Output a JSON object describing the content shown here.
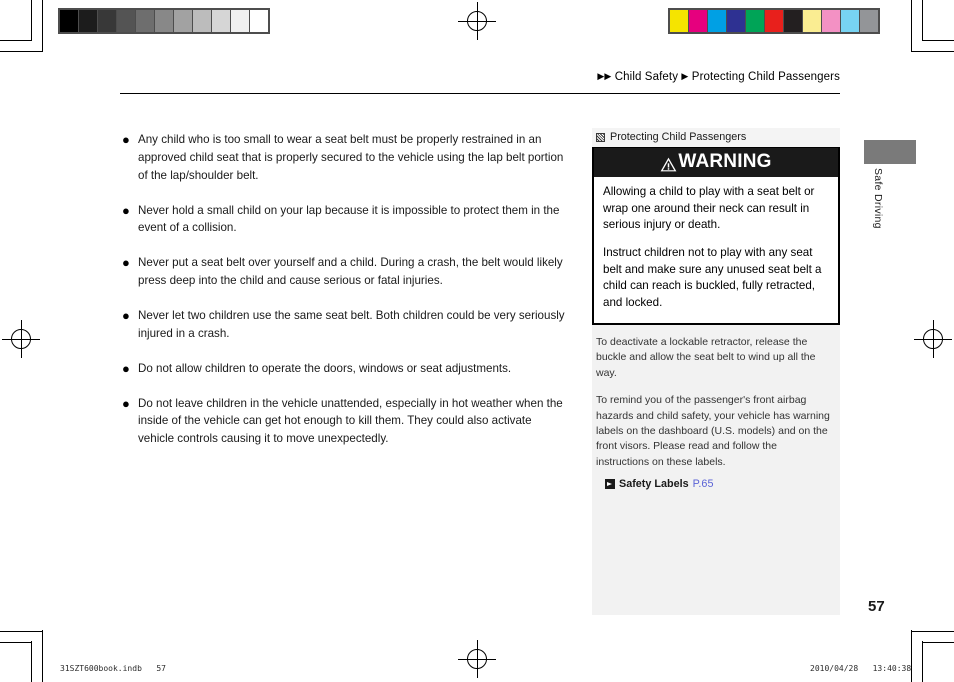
{
  "breadcrumb": {
    "arrow_glyph": "▶",
    "section": "Child Safety",
    "subsection": "Protecting Child Passengers"
  },
  "main": {
    "bullet_glyph": "●",
    "bullets": [
      "Any child who is too small to wear a seat belt must be properly restrained in an approved child seat that is properly secured to the vehicle using the lap belt portion of the lap/shoulder belt.",
      "Never hold a small child on your lap because it is impossible to protect them in the event of a collision.",
      "Never put a seat belt over yourself and a child. During a crash, the belt would likely press deep into the child and cause serious or fatal injuries.",
      "Never let two children use the same seat belt. Both children could be very seriously injured in a crash.",
      "Do not allow children to operate the doors, windows or seat adjustments.",
      "Do not leave children in the vehicle unattended, especially in hot weather when the inside of the vehicle can get hot enough to kill them. They could also activate vehicle controls causing it to move unexpectedly."
    ]
  },
  "sidebar": {
    "header_label": "Protecting Child Passengers",
    "warning": {
      "title": "WARNING",
      "paragraphs": [
        "Allowing a child to play with a seat belt or wrap one around their neck can result in serious injury or death.",
        "Instruct children not to play with any seat belt and make sure any unused seat belt a child can reach is buckled, fully retracted, and locked."
      ]
    },
    "notes": [
      "To deactivate a lockable retractor, release the buckle and allow the seat belt to wind up all the way.",
      "To remind you of the passenger's front airbag hazards and child safety, your vehicle has warning labels on the dashboard (U.S. models) and on the front visors. Please read and follow the instructions on these labels."
    ],
    "cross_reference": {
      "label": "Safety Labels",
      "page": "P.65"
    }
  },
  "side_tab": {
    "label": "Safe Driving"
  },
  "page_number": "57",
  "footer": {
    "left": "31SZT600book.indb   57",
    "right": "2010/04/28   13:40:38"
  },
  "calibration": {
    "gray_swatches": [
      "#000000",
      "#1c1c1c",
      "#383838",
      "#545454",
      "#6e6e6e",
      "#888888",
      "#a2a2a2",
      "#bcbcbc",
      "#d6d6d6",
      "#f0f0f0",
      "#ffffff"
    ],
    "color_swatches": [
      "#f5e400",
      "#e6007e",
      "#00a0e4",
      "#2e3192",
      "#00a457",
      "#e8201c",
      "#231f20",
      "#faed92",
      "#f391c4",
      "#77d3f2",
      "#939598"
    ]
  }
}
